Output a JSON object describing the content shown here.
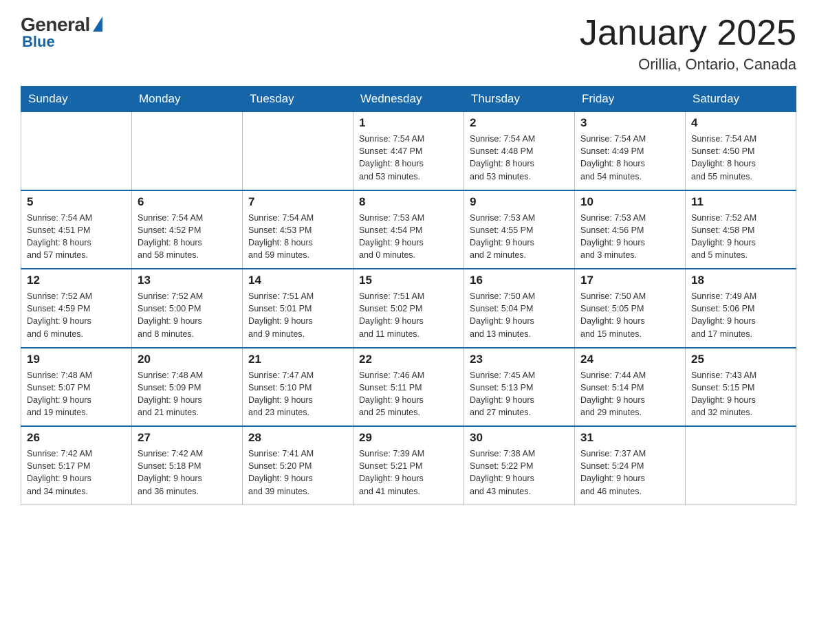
{
  "header": {
    "logo_general": "General",
    "logo_blue": "Blue",
    "month_title": "January 2025",
    "location": "Orillia, Ontario, Canada"
  },
  "days_of_week": [
    "Sunday",
    "Monday",
    "Tuesday",
    "Wednesday",
    "Thursday",
    "Friday",
    "Saturday"
  ],
  "weeks": [
    [
      {
        "day": "",
        "info": ""
      },
      {
        "day": "",
        "info": ""
      },
      {
        "day": "",
        "info": ""
      },
      {
        "day": "1",
        "info": "Sunrise: 7:54 AM\nSunset: 4:47 PM\nDaylight: 8 hours\nand 53 minutes."
      },
      {
        "day": "2",
        "info": "Sunrise: 7:54 AM\nSunset: 4:48 PM\nDaylight: 8 hours\nand 53 minutes."
      },
      {
        "day": "3",
        "info": "Sunrise: 7:54 AM\nSunset: 4:49 PM\nDaylight: 8 hours\nand 54 minutes."
      },
      {
        "day": "4",
        "info": "Sunrise: 7:54 AM\nSunset: 4:50 PM\nDaylight: 8 hours\nand 55 minutes."
      }
    ],
    [
      {
        "day": "5",
        "info": "Sunrise: 7:54 AM\nSunset: 4:51 PM\nDaylight: 8 hours\nand 57 minutes."
      },
      {
        "day": "6",
        "info": "Sunrise: 7:54 AM\nSunset: 4:52 PM\nDaylight: 8 hours\nand 58 minutes."
      },
      {
        "day": "7",
        "info": "Sunrise: 7:54 AM\nSunset: 4:53 PM\nDaylight: 8 hours\nand 59 minutes."
      },
      {
        "day": "8",
        "info": "Sunrise: 7:53 AM\nSunset: 4:54 PM\nDaylight: 9 hours\nand 0 minutes."
      },
      {
        "day": "9",
        "info": "Sunrise: 7:53 AM\nSunset: 4:55 PM\nDaylight: 9 hours\nand 2 minutes."
      },
      {
        "day": "10",
        "info": "Sunrise: 7:53 AM\nSunset: 4:56 PM\nDaylight: 9 hours\nand 3 minutes."
      },
      {
        "day": "11",
        "info": "Sunrise: 7:52 AM\nSunset: 4:58 PM\nDaylight: 9 hours\nand 5 minutes."
      }
    ],
    [
      {
        "day": "12",
        "info": "Sunrise: 7:52 AM\nSunset: 4:59 PM\nDaylight: 9 hours\nand 6 minutes."
      },
      {
        "day": "13",
        "info": "Sunrise: 7:52 AM\nSunset: 5:00 PM\nDaylight: 9 hours\nand 8 minutes."
      },
      {
        "day": "14",
        "info": "Sunrise: 7:51 AM\nSunset: 5:01 PM\nDaylight: 9 hours\nand 9 minutes."
      },
      {
        "day": "15",
        "info": "Sunrise: 7:51 AM\nSunset: 5:02 PM\nDaylight: 9 hours\nand 11 minutes."
      },
      {
        "day": "16",
        "info": "Sunrise: 7:50 AM\nSunset: 5:04 PM\nDaylight: 9 hours\nand 13 minutes."
      },
      {
        "day": "17",
        "info": "Sunrise: 7:50 AM\nSunset: 5:05 PM\nDaylight: 9 hours\nand 15 minutes."
      },
      {
        "day": "18",
        "info": "Sunrise: 7:49 AM\nSunset: 5:06 PM\nDaylight: 9 hours\nand 17 minutes."
      }
    ],
    [
      {
        "day": "19",
        "info": "Sunrise: 7:48 AM\nSunset: 5:07 PM\nDaylight: 9 hours\nand 19 minutes."
      },
      {
        "day": "20",
        "info": "Sunrise: 7:48 AM\nSunset: 5:09 PM\nDaylight: 9 hours\nand 21 minutes."
      },
      {
        "day": "21",
        "info": "Sunrise: 7:47 AM\nSunset: 5:10 PM\nDaylight: 9 hours\nand 23 minutes."
      },
      {
        "day": "22",
        "info": "Sunrise: 7:46 AM\nSunset: 5:11 PM\nDaylight: 9 hours\nand 25 minutes."
      },
      {
        "day": "23",
        "info": "Sunrise: 7:45 AM\nSunset: 5:13 PM\nDaylight: 9 hours\nand 27 minutes."
      },
      {
        "day": "24",
        "info": "Sunrise: 7:44 AM\nSunset: 5:14 PM\nDaylight: 9 hours\nand 29 minutes."
      },
      {
        "day": "25",
        "info": "Sunrise: 7:43 AM\nSunset: 5:15 PM\nDaylight: 9 hours\nand 32 minutes."
      }
    ],
    [
      {
        "day": "26",
        "info": "Sunrise: 7:42 AM\nSunset: 5:17 PM\nDaylight: 9 hours\nand 34 minutes."
      },
      {
        "day": "27",
        "info": "Sunrise: 7:42 AM\nSunset: 5:18 PM\nDaylight: 9 hours\nand 36 minutes."
      },
      {
        "day": "28",
        "info": "Sunrise: 7:41 AM\nSunset: 5:20 PM\nDaylight: 9 hours\nand 39 minutes."
      },
      {
        "day": "29",
        "info": "Sunrise: 7:39 AM\nSunset: 5:21 PM\nDaylight: 9 hours\nand 41 minutes."
      },
      {
        "day": "30",
        "info": "Sunrise: 7:38 AM\nSunset: 5:22 PM\nDaylight: 9 hours\nand 43 minutes."
      },
      {
        "day": "31",
        "info": "Sunrise: 7:37 AM\nSunset: 5:24 PM\nDaylight: 9 hours\nand 46 minutes."
      },
      {
        "day": "",
        "info": ""
      }
    ]
  ]
}
